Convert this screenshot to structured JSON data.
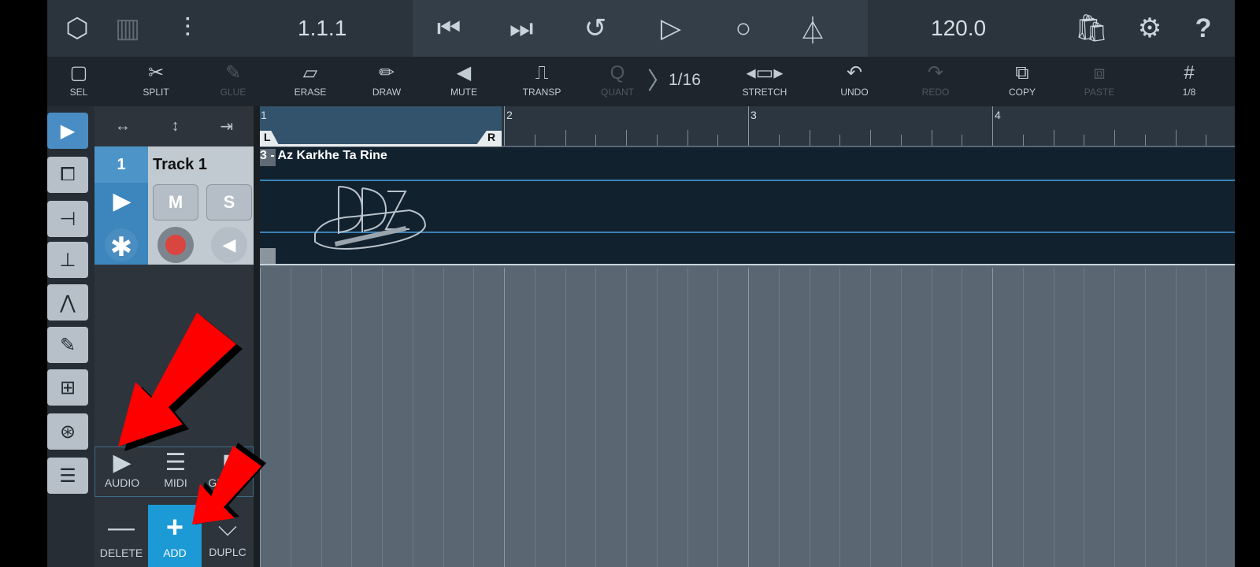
{
  "topbar": {
    "position": "1.1.1",
    "tempo": "120.0",
    "icons": [
      "song-icon",
      "piano-keys-icon",
      "mixer-icon",
      "skip-back-icon",
      "skip-forward-icon",
      "loop-icon",
      "play-icon",
      "record-icon",
      "metronome-icon",
      "shop-icon",
      "gear-icon",
      "help-icon"
    ]
  },
  "toolbar": {
    "tools": [
      {
        "label": "SEL",
        "icon": "select-icon",
        "enabled": true
      },
      {
        "label": "SPLIT",
        "icon": "scissors-icon",
        "enabled": true
      },
      {
        "label": "GLUE",
        "icon": "glue-icon",
        "enabled": false
      },
      {
        "label": "ERASE",
        "icon": "eraser-icon",
        "enabled": true
      },
      {
        "label": "DRAW",
        "icon": "pencil-icon",
        "enabled": true
      },
      {
        "label": "MUTE",
        "icon": "speaker-icon",
        "enabled": true
      },
      {
        "label": "TRANSP",
        "icon": "transpose-icon",
        "enabled": true
      },
      {
        "label": "QUANT",
        "icon": "quantize-icon",
        "enabled": false
      }
    ],
    "quant_value": "1/16",
    "actions": [
      {
        "label": "STRETCH",
        "icon": "stretch-icon",
        "enabled": true
      },
      {
        "label": "UNDO",
        "icon": "undo-icon",
        "enabled": true
      },
      {
        "label": "REDO",
        "icon": "redo-icon",
        "enabled": false
      },
      {
        "label": "COPY",
        "icon": "copy-icon",
        "enabled": true
      },
      {
        "label": "PASTE",
        "icon": "paste-icon",
        "enabled": false
      },
      {
        "label": "1/8",
        "icon": "grid-icon",
        "enabled": true
      }
    ]
  },
  "track": {
    "number": "1",
    "name": "Track 1",
    "mute": "M",
    "solo": "S"
  },
  "ruler": {
    "bars": [
      "1",
      "2",
      "3",
      "4"
    ],
    "loop_left": "L",
    "loop_right": "R"
  },
  "clip": {
    "title": "3 - Az Karkhe Ta Rine"
  },
  "add_menu": {
    "audio": "AUDIO",
    "midi": "MIDI",
    "group": "GROUP"
  },
  "bottom": {
    "delete": "DELETE",
    "add": "ADD",
    "duplicate": "DUPLC"
  },
  "colors": {
    "accent": "#4a8dc4",
    "add_active": "#1b9ad6",
    "record": "#d9453f",
    "annotation_arrow": "#ff0000"
  }
}
